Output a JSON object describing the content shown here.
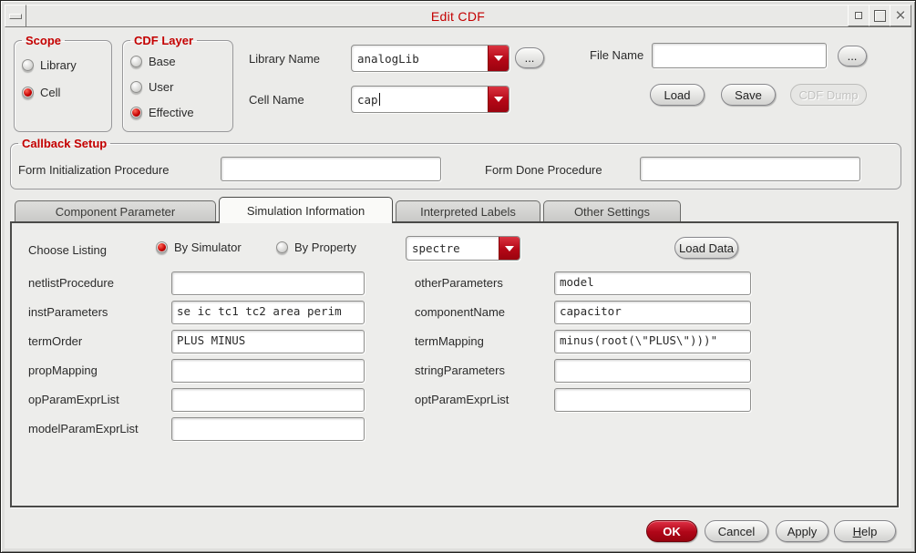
{
  "window": {
    "title": "Edit CDF"
  },
  "icons": {
    "window_menu": "dash",
    "iconify": "small-square",
    "maximize": "square",
    "close": "x",
    "dropdown_arrow": "triangle-down"
  },
  "colors": {
    "accent_red": "#c40000",
    "background": "#ebebe9",
    "field_bg": "#ffffff"
  },
  "scope": {
    "title": "Scope",
    "options": [
      {
        "label": "Library",
        "selected": false
      },
      {
        "label": "Cell",
        "selected": true
      }
    ]
  },
  "cdf_layer": {
    "title": "CDF Layer",
    "options": [
      {
        "label": "Base",
        "selected": false
      },
      {
        "label": "User",
        "selected": false
      },
      {
        "label": "Effective",
        "selected": true
      }
    ]
  },
  "name_fields": {
    "library_name": {
      "label": "Library Name",
      "value": "analogLib"
    },
    "cell_name": {
      "label": "Cell Name",
      "value": "cap"
    },
    "file_name": {
      "label": "File Name",
      "value": ""
    }
  },
  "buttons": {
    "browse": "...",
    "load": "Load",
    "save": "Save",
    "cdf_dump": "CDF Dump",
    "load_data": "Load Data",
    "ok": "OK",
    "cancel": "Cancel",
    "apply": "Apply",
    "help_underline": "H",
    "help_rest": "elp"
  },
  "callback_setup": {
    "title": "Callback Setup",
    "form_init": {
      "label": "Form Initialization Procedure",
      "value": ""
    },
    "form_done": {
      "label": "Form Done Procedure",
      "value": ""
    }
  },
  "tabs": [
    {
      "label": "Component Parameter",
      "active": false
    },
    {
      "label": "Simulation Information",
      "active": true
    },
    {
      "label": "Interpreted Labels",
      "active": false
    },
    {
      "label": "Other Settings",
      "active": false
    }
  ],
  "simulation_tab": {
    "choose_listing": {
      "label": "Choose Listing",
      "options": [
        {
          "label": "By Simulator",
          "selected": true
        },
        {
          "label": "By Property",
          "selected": false
        }
      ],
      "simulator": "spectre"
    },
    "left_fields": [
      {
        "label": "netlistProcedure",
        "value": ""
      },
      {
        "label": "instParameters",
        "value": "se ic tc1 tc2 area perim"
      },
      {
        "label": "termOrder",
        "value": "PLUS MINUS"
      },
      {
        "label": "propMapping",
        "value": ""
      },
      {
        "label": "opParamExprList",
        "value": ""
      },
      {
        "label": "modelParamExprList",
        "value": ""
      }
    ],
    "right_fields": [
      {
        "label": "otherParameters",
        "value": "model"
      },
      {
        "label": "componentName",
        "value": "capacitor"
      },
      {
        "label": "termMapping",
        "value": "minus(root(\\\"PLUS\\\")))\""
      },
      {
        "label": "stringParameters",
        "value": ""
      },
      {
        "label": "optParamExprList",
        "value": ""
      }
    ]
  }
}
